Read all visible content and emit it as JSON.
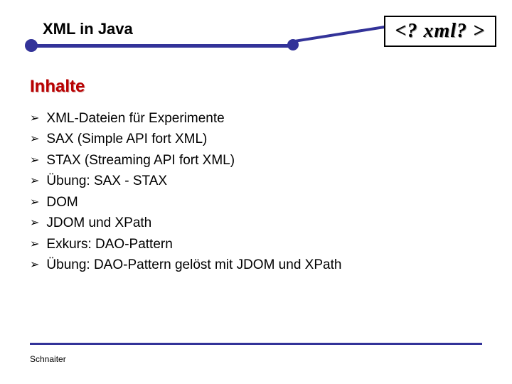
{
  "header": {
    "title": "XML in Java",
    "badge": "<? xml? >"
  },
  "section_title": "Inhalte",
  "bullets": [
    "XML-Dateien für Experimente",
    "SAX (Simple API fort XML)",
    "STAX (Streaming API fort XML)",
    "Übung: SAX - STAX",
    "DOM",
    "JDOM und XPath",
    "Exkurs: DAO-Pattern",
    "Übung: DAO-Pattern gelöst mit JDOM und XPath"
  ],
  "footer": "Schnaiter"
}
